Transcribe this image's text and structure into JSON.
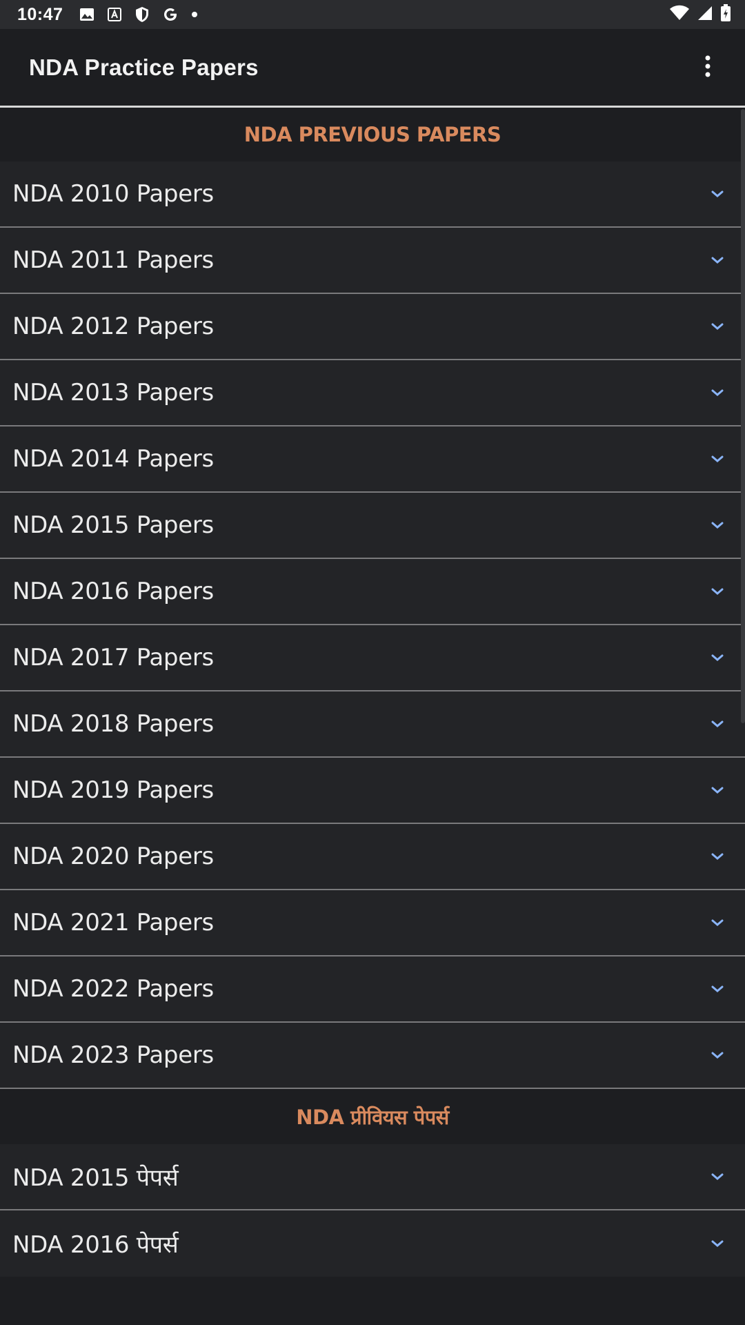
{
  "status_bar": {
    "time": "10:47",
    "left_icons": [
      "image-icon",
      "text-icon",
      "shield-icon",
      "google-icon",
      "dot-icon"
    ],
    "right_icons": [
      "wifi-icon",
      "signal-icon",
      "battery-icon"
    ]
  },
  "app_bar": {
    "title": "NDA Practice Papers",
    "overflow_icon": "more-vert-icon"
  },
  "sections": [
    {
      "title": "NDA PREVIOUS PAPERS",
      "items": [
        "NDA 2010 Papers",
        "NDA 2011 Papers",
        "NDA 2012 Papers",
        "NDA 2013 Papers",
        "NDA 2014 Papers",
        "NDA 2015 Papers",
        "NDA 2016 Papers",
        "NDA 2017 Papers",
        "NDA 2018 Papers",
        "NDA 2019 Papers",
        "NDA 2020 Papers",
        "NDA 2021 Papers",
        "NDA 2022 Papers",
        "NDA 2023 Papers"
      ]
    },
    {
      "title": "NDA प्रीवियस पेपर्स",
      "items": [
        "NDA 2015 पेपर्स",
        "NDA 2016 पेपर्स"
      ]
    }
  ],
  "colors": {
    "background": "#1d1e21",
    "row_background": "#232427",
    "section_title": "#d98a5e",
    "chevron": "#8ab4f8",
    "divider": "#7a7a7c"
  }
}
